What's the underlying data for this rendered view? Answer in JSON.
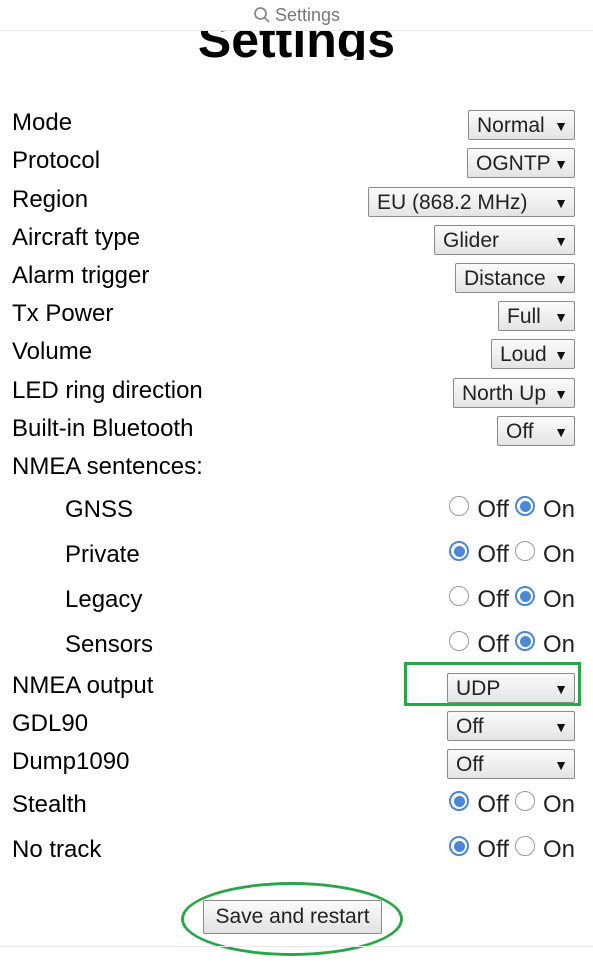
{
  "browser": {
    "search_text": "Settings",
    "search_icon": "search-icon"
  },
  "page": {
    "title": "Settings"
  },
  "settings": [
    {
      "label": "Mode",
      "value": "Normal"
    },
    {
      "label": "Protocol",
      "value": "OGNTP"
    },
    {
      "label": "Region",
      "value": "EU (868.2 MHz)"
    },
    {
      "label": "Aircraft type",
      "value": "Glider"
    },
    {
      "label": "Alarm trigger",
      "value": "Distance"
    },
    {
      "label": "Tx Power",
      "value": "Full"
    },
    {
      "label": "Volume",
      "value": "Loud"
    },
    {
      "label": "LED ring direction",
      "value": "North Up"
    },
    {
      "label": "Built-in Bluetooth",
      "value": "Off"
    }
  ],
  "nmea_sentences": {
    "label": "NMEA sentences:",
    "items": [
      {
        "label": "GNSS",
        "off": "Off",
        "on": "On",
        "selected": "On"
      },
      {
        "label": "Private",
        "off": "Off",
        "on": "On",
        "selected": "Off"
      },
      {
        "label": "Legacy",
        "off": "Off",
        "on": "On",
        "selected": "On"
      },
      {
        "label": "Sensors",
        "off": "Off",
        "on": "On",
        "selected": "On"
      }
    ]
  },
  "outputs": [
    {
      "label": "NMEA output",
      "value": "UDP"
    },
    {
      "label": "GDL90",
      "value": "Off"
    },
    {
      "label": "Dump1090",
      "value": "Off"
    }
  ],
  "toggles": [
    {
      "label": "Stealth",
      "off": "Off",
      "on": "On",
      "selected": "Off"
    },
    {
      "label": "No track",
      "off": "Off",
      "on": "On",
      "selected": "Off"
    }
  ],
  "save_button": {
    "label": "Save and restart"
  },
  "annotation_color": "#2aa64a",
  "accent_color": "#4c86d6"
}
